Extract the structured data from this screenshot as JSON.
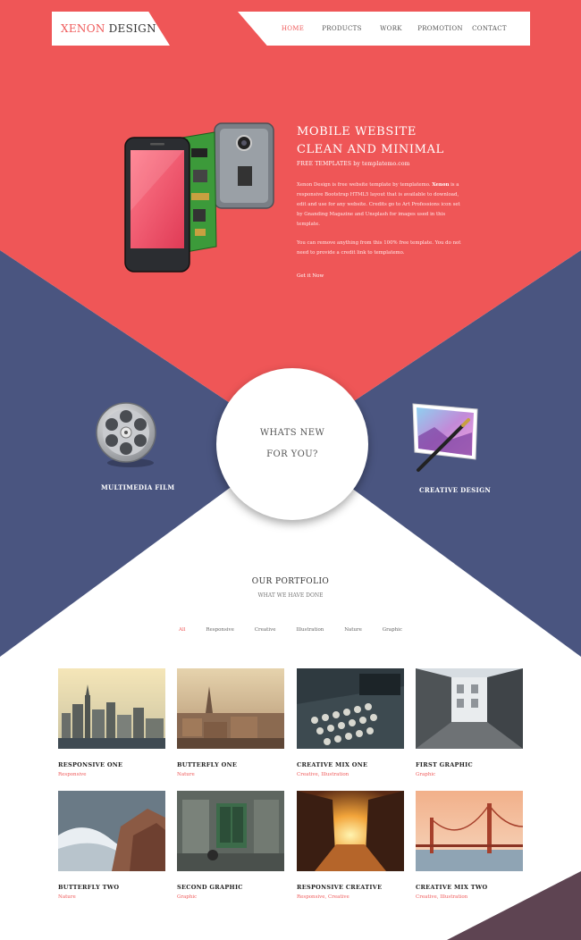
{
  "header": {
    "logo_part1": "XENON",
    "logo_part2": "DESIGN",
    "nav": [
      "HOME",
      "PRODUCTS",
      "WORK",
      "PROMOTION",
      "CONTACT"
    ]
  },
  "hero": {
    "title_line1": "MOBILE WEBSITE",
    "title_line2": "CLEAN AND MINIMAL",
    "subtitle": "FREE TEMPLATES by templatemo.com",
    "p1_a": "Xenon Design is free website template by templatemo.",
    "p1_bold": "Xenon",
    "p1_b": "is a responsive Bootstrap HTML5 layout that is available to download, edit and use for any website. Credits go to Art Professions icon set by Gnanding Magazine and Unsplash for images used in this template.",
    "p2": "You can remove anything from this 100% free template. You do not need to provide a credit link to templatemo.",
    "cta": "Get it Now"
  },
  "circle": {
    "line1": "WHATS NEW",
    "line2": "FOR YOU?"
  },
  "features": {
    "left_label": "MULTIMEDIA FILM",
    "right_label": "CREATIVE DESIGN"
  },
  "portfolio": {
    "title": "OUR PORTFOLIO",
    "subtitle": "WHAT WE HAVE DONE",
    "filters": [
      "All",
      "Responsive",
      "Creative",
      "Illustration",
      "Nature",
      "Graphic"
    ],
    "items": [
      {
        "title": "RESPONSIVE ONE",
        "category": "Responsive"
      },
      {
        "title": "BUTTERFLY ONE",
        "category": "Nature"
      },
      {
        "title": "CREATIVE MIX ONE",
        "category": "Creative, Illustration"
      },
      {
        "title": "FIRST GRAPHIC",
        "category": "Graphic"
      },
      {
        "title": "BUTTERFLY TWO",
        "category": "Nature"
      },
      {
        "title": "SECOND GRAPHIC",
        "category": "Graphic"
      },
      {
        "title": "RESPONSIVE CREATIVE",
        "category": "Responsive, Creative"
      },
      {
        "title": "CREATIVE MIX TWO",
        "category": "Creative, Illustration"
      }
    ]
  },
  "colors": {
    "red": "#ef5657",
    "navy": "#4a5580",
    "white": "#ffffff",
    "corner": "#5e4452"
  }
}
